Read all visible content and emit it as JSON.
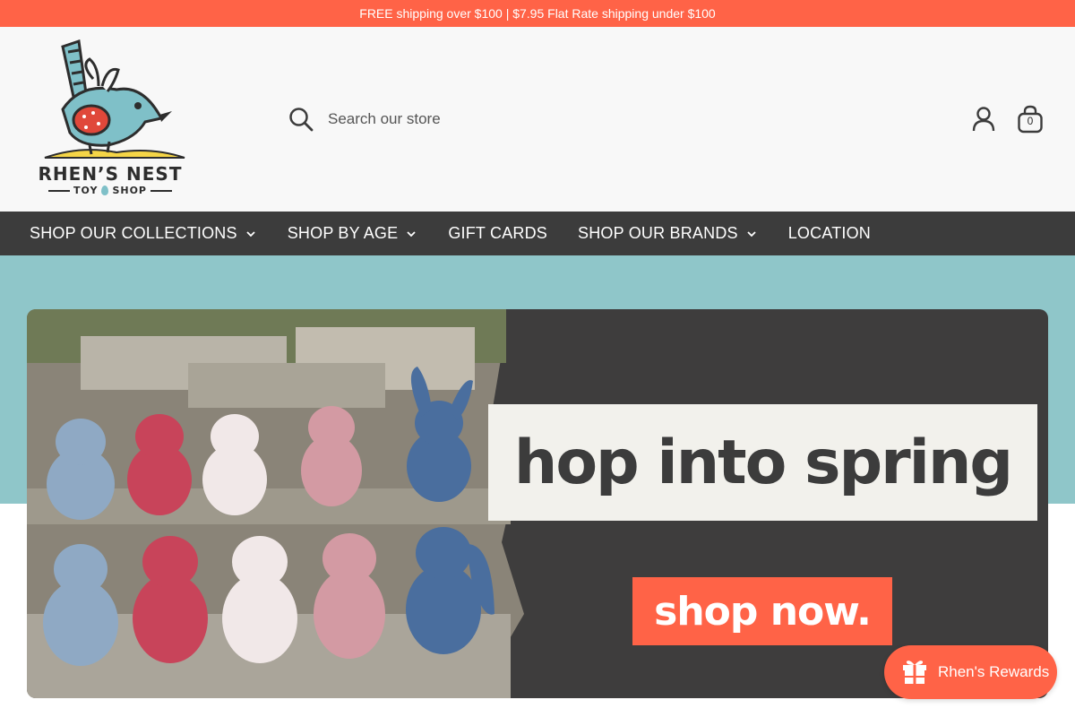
{
  "announcement": {
    "text": "FREE shipping over $100 | $7.95 Flat Rate shipping under $100"
  },
  "logo": {
    "name": "RHEN’S NEST",
    "tagline_left": "TOY",
    "tagline_right": "SHOP",
    "icon": "bird-logo"
  },
  "search": {
    "placeholder": "Search our store",
    "icon": "search-icon"
  },
  "header_icons": {
    "account": "user-icon",
    "cart": "shopping-bag-icon",
    "cart_count": "0"
  },
  "nav": {
    "items": [
      {
        "label": "SHOP OUR COLLECTIONS",
        "dropdown": true
      },
      {
        "label": "SHOP BY AGE",
        "dropdown": true
      },
      {
        "label": "GIFT CARDS",
        "dropdown": false
      },
      {
        "label": "SHOP OUR BRANDS",
        "dropdown": true
      },
      {
        "label": "LOCATION",
        "dropdown": false
      }
    ]
  },
  "hero": {
    "headline": "hop into spring",
    "cta": "shop now."
  },
  "rewards": {
    "label": "Rhen's Rewards",
    "icon": "gift-icon"
  },
  "colors": {
    "accent": "#ff6347",
    "nav_bg": "#3c3c3c",
    "hero_bg": "#8fc6c9",
    "banner_bg": "#3e3d3d",
    "header_bg": "#f8f8f8"
  }
}
